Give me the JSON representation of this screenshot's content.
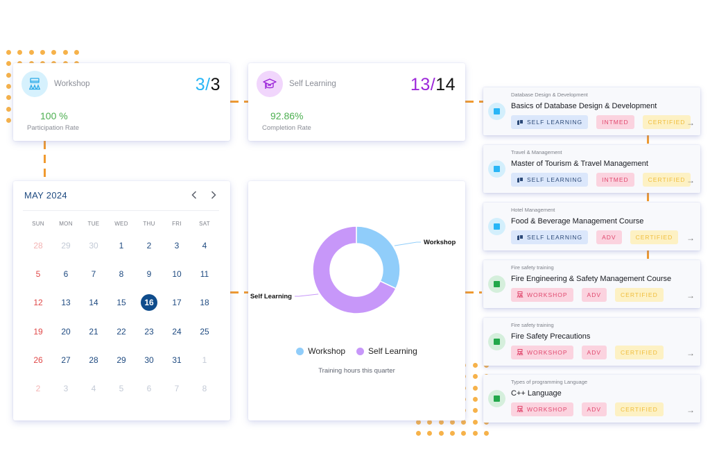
{
  "colors": {
    "accent_orange": "#f09a2f",
    "workshop_blue": "#29b6f6",
    "self_learning_purple": "#9c27d9",
    "success_green": "#4caf50",
    "calendar_navy": "#1e4a80",
    "weekend_red": "#e04848"
  },
  "stats": [
    {
      "title": "Workshop",
      "icon": "workshop-icon",
      "done": "3",
      "total": "3",
      "sep": "/",
      "rate": "100 %",
      "rate_label": "Participation Rate"
    },
    {
      "title": "Self Learning",
      "icon": "graduation-cap-icon",
      "done": "13",
      "total": "14",
      "sep": "/",
      "rate": "92.86%",
      "rate_label": "Completion Rate"
    }
  ],
  "calendar": {
    "title": "MAY 2024",
    "prev_icon": "chevron-left-icon",
    "next_icon": "chevron-right-icon",
    "weekdays": [
      "SUN",
      "MON",
      "TUE",
      "WED",
      "THU",
      "FRI",
      "SAT"
    ],
    "selected_day": "16",
    "weeks": [
      [
        {
          "d": "28",
          "m": true
        },
        {
          "d": "29",
          "m": true
        },
        {
          "d": "30",
          "m": true
        },
        {
          "d": "1"
        },
        {
          "d": "2"
        },
        {
          "d": "3"
        },
        {
          "d": "4"
        }
      ],
      [
        {
          "d": "5"
        },
        {
          "d": "6"
        },
        {
          "d": "7"
        },
        {
          "d": "8"
        },
        {
          "d": "9"
        },
        {
          "d": "10"
        },
        {
          "d": "11"
        }
      ],
      [
        {
          "d": "12"
        },
        {
          "d": "13"
        },
        {
          "d": "14"
        },
        {
          "d": "15"
        },
        {
          "d": "16",
          "t": true
        },
        {
          "d": "17"
        },
        {
          "d": "18"
        }
      ],
      [
        {
          "d": "19"
        },
        {
          "d": "20"
        },
        {
          "d": "21"
        },
        {
          "d": "22"
        },
        {
          "d": "23"
        },
        {
          "d": "24"
        },
        {
          "d": "25"
        }
      ],
      [
        {
          "d": "26"
        },
        {
          "d": "27"
        },
        {
          "d": "28"
        },
        {
          "d": "29"
        },
        {
          "d": "30"
        },
        {
          "d": "31"
        },
        {
          "d": "1",
          "m": true
        }
      ],
      [
        {
          "d": "2",
          "m": true
        },
        {
          "d": "3",
          "m": true
        },
        {
          "d": "4",
          "m": true
        },
        {
          "d": "5",
          "m": true
        },
        {
          "d": "6",
          "m": true
        },
        {
          "d": "7",
          "m": true
        },
        {
          "d": "8",
          "m": true
        }
      ]
    ]
  },
  "chart_data": {
    "type": "pie",
    "variant": "donut",
    "title": "Training hours this quarter",
    "categories": [
      "Workshop",
      "Self Learning"
    ],
    "values": [
      32,
      68
    ],
    "unit": "percent of training hours (estimated)",
    "colors": [
      "#90cdfa",
      "#c797f9"
    ],
    "legend": {
      "placement": "bottom",
      "entries": [
        "Workshop",
        "Self Learning"
      ]
    },
    "labels": [
      "Workshop",
      "Self Learning"
    ]
  },
  "courses": [
    {
      "category": "Database Design & Development",
      "title": "Basics of Database Design & Development",
      "type": "SELF LEARNING",
      "type_kind": "self",
      "level": "INTMED",
      "cert": "CERTIFIED",
      "bullet": "blue"
    },
    {
      "category": "Travel & Management",
      "title": "Master of Tourism & Travel Management",
      "type": "SELF LEARNING",
      "type_kind": "self",
      "level": "INTMED",
      "cert": "CERTIFIED",
      "bullet": "blue"
    },
    {
      "category": "Hotel Management",
      "title": "Food & Beverage Management Course",
      "type": "SELF LEARNING",
      "type_kind": "self",
      "level": "ADV",
      "cert": "CERTIFIED",
      "bullet": "blue"
    },
    {
      "category": "Fire safety training",
      "title": "Fire Engineering & Safety Management Course",
      "type": "WORKSHOP",
      "type_kind": "work",
      "level": "ADV",
      "cert": "CERTIFIED",
      "bullet": "green"
    },
    {
      "category": "Fire safety training",
      "title": "Fire Safety Precautions",
      "type": "WORKSHOP",
      "type_kind": "work",
      "level": "ADV",
      "cert": "CERTIFIED",
      "bullet": "green"
    },
    {
      "category": "Types of programming Language",
      "title": "C++ Language",
      "type": "WORKSHOP",
      "type_kind": "work",
      "level": "ADV",
      "cert": "CERTIFIED",
      "bullet": "green"
    }
  ],
  "course_arrow": "→"
}
